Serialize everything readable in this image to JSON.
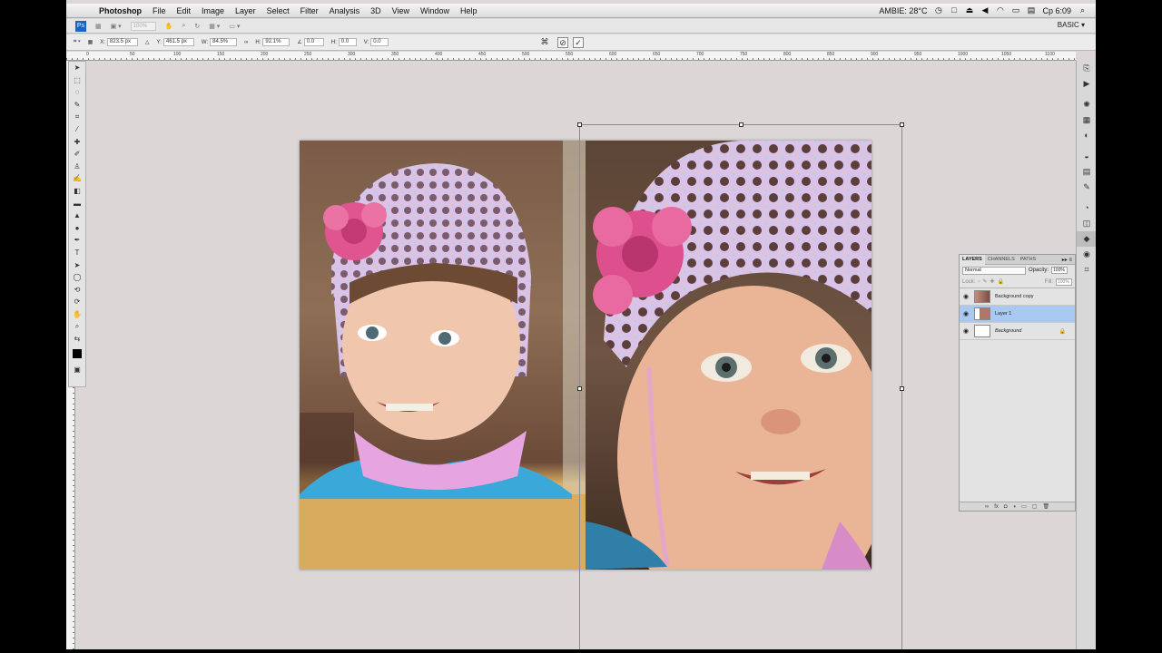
{
  "menubar": {
    "app_name": "Photoshop",
    "items": [
      "File",
      "Edit",
      "Image",
      "Layer",
      "Select",
      "Filter",
      "Analysis",
      "3D",
      "View",
      "Window",
      "Help"
    ],
    "status_text": "AMBIE: 28°C",
    "clock": "Cp 6:09"
  },
  "appbar": {
    "zoom_value": "100%",
    "workspace": "BASIC"
  },
  "options": {
    "x_label": "X:",
    "x_value": "823.5 px",
    "y_label": "Y:",
    "y_value": "461.5 px",
    "w_label": "W:",
    "w_value": "84.5%",
    "h_label": "H:",
    "h_value": "92.1%",
    "angle_value": "0.0",
    "hskew_label": "H:",
    "hskew_value": "0.0",
    "vskew_label": "V:",
    "vskew_value": "0.0"
  },
  "ruler_ticks": [
    "0",
    "50",
    "100",
    "150",
    "200",
    "250",
    "300",
    "350",
    "400",
    "450",
    "500",
    "550",
    "600",
    "650",
    "700",
    "750",
    "800",
    "850",
    "900",
    "950",
    "1000",
    "1050",
    "1100"
  ],
  "layers_panel": {
    "tabs": [
      "LAYERS",
      "CHANNELS",
      "PATHS"
    ],
    "blend_mode": "Normal",
    "opacity_label": "Opacity:",
    "opacity_value": "100%",
    "lock_label": "Lock:",
    "fill_label": "Fill:",
    "fill_value": "100%",
    "layers": [
      {
        "name": "Background copy",
        "selected": false,
        "locked": false
      },
      {
        "name": "Layer 1",
        "selected": true,
        "locked": false
      },
      {
        "name": "Background",
        "selected": false,
        "locked": true
      }
    ]
  },
  "colors": {
    "selection": "#a9c8f2",
    "workspace_bg": "#dcd7d6",
    "ps_logo": "#1c64c4"
  }
}
